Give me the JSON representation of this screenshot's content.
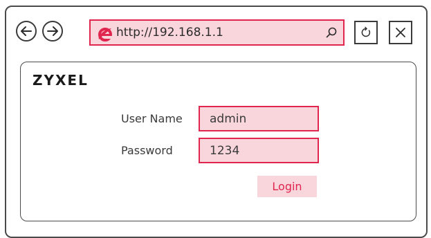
{
  "browser": {
    "address_bar": {
      "url": "http://192.168.1.1"
    },
    "icons": {
      "back": "arrow-left-icon",
      "forward": "arrow-right-icon",
      "browser_logo": "internet-explorer-icon",
      "search": "search-icon",
      "refresh": "refresh-icon",
      "close": "close-icon"
    }
  },
  "page": {
    "brand": "ZYXEL",
    "login_form": {
      "username_label": "User Name",
      "username_value": "admin",
      "password_label": "Password",
      "password_value": "1234",
      "login_button": "Login"
    }
  },
  "colors": {
    "highlight_fill": "#f9d5dc",
    "highlight_border": "#e0254f",
    "outline": "#3a3a3a"
  }
}
